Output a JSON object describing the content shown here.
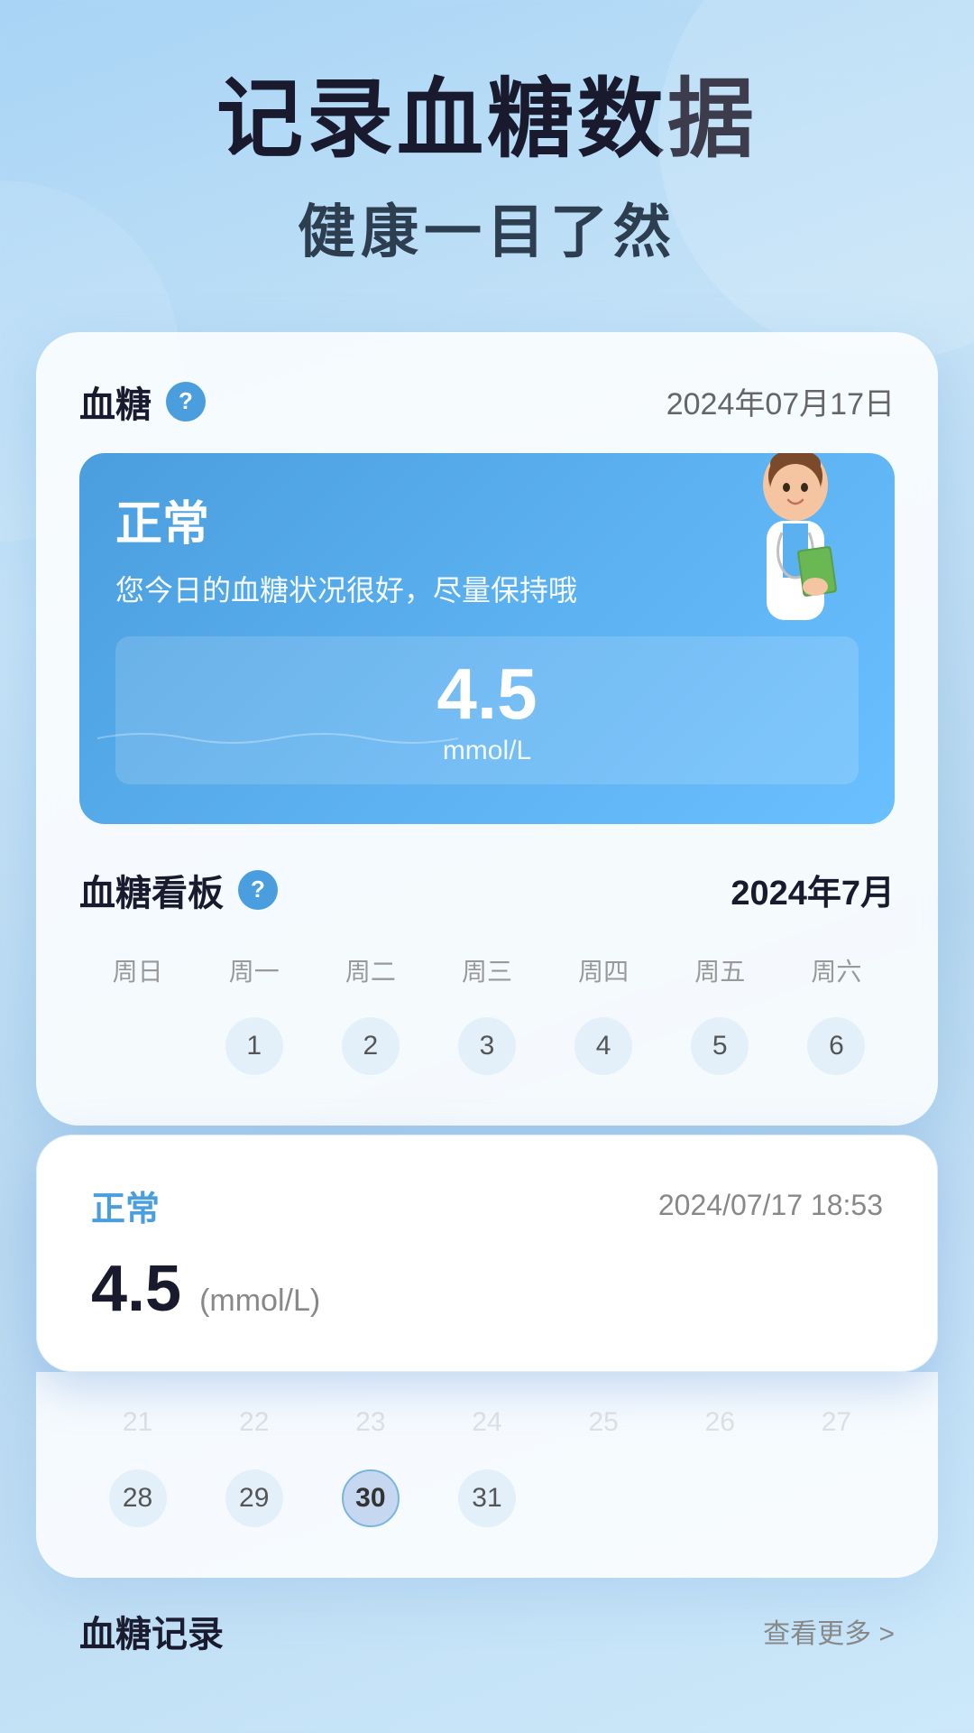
{
  "hero": {
    "title": "记录血糖数据",
    "subtitle": "健康一目了然"
  },
  "card": {
    "title": "血糖",
    "help_label": "?",
    "date": "2024年07月17日",
    "status": {
      "label": "正常",
      "description": "您今日的血糖状况很好，尽量保持哦",
      "value": "4.5",
      "unit": "mmol/L"
    }
  },
  "calendar": {
    "title": "血糖看板",
    "help_label": "?",
    "month": "2024年7月",
    "weekdays": [
      "周日",
      "周一",
      "周二",
      "周三",
      "周四",
      "周五",
      "周六"
    ],
    "week1": [
      "",
      "1",
      "2",
      "3",
      "4",
      "5",
      "6"
    ],
    "week2_faded": [
      "21",
      "22",
      "23",
      "24",
      "25",
      "26",
      "27"
    ],
    "week_last": [
      "28",
      "29",
      "30",
      "31",
      "",
      "",
      ""
    ]
  },
  "popup": {
    "status": "正常",
    "datetime": "2024/07/17 18:53",
    "value": "4.5",
    "unit": "(mmol/L)"
  },
  "record_section": {
    "title": "血糖记录",
    "view_more": "查看更多 >"
  }
}
